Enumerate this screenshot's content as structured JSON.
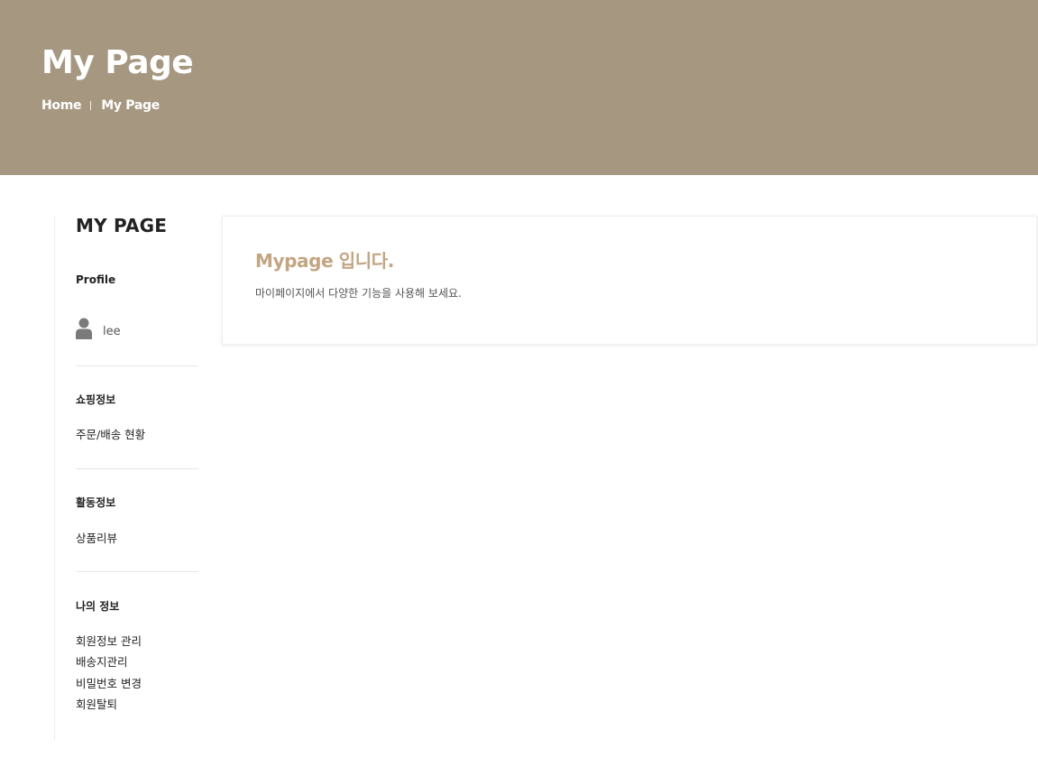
{
  "header": {
    "title": "My Page",
    "breadcrumb": [
      "Home",
      "My Page"
    ]
  },
  "sidebar": {
    "title": "MY PAGE",
    "profile": {
      "heading": "Profile",
      "username": "lee",
      "icon": "user-icon"
    },
    "sections": [
      {
        "heading": "쇼핑정보",
        "links": [
          "주문/배송 현황"
        ]
      },
      {
        "heading": "활동정보",
        "links": [
          "상품리뷰"
        ]
      },
      {
        "heading": "나의 정보",
        "links": [
          "회원정보 관리",
          "배송지관리",
          "비밀번호 변경",
          "회원탈퇴"
        ]
      }
    ]
  },
  "main": {
    "title": "Mypage 입니다.",
    "description": "마이페이지에서 다양한 기능을 사용해 보세요."
  },
  "colors": {
    "hero_background": "#a69781",
    "accent": "#c3a582",
    "text_dark": "#222222"
  }
}
